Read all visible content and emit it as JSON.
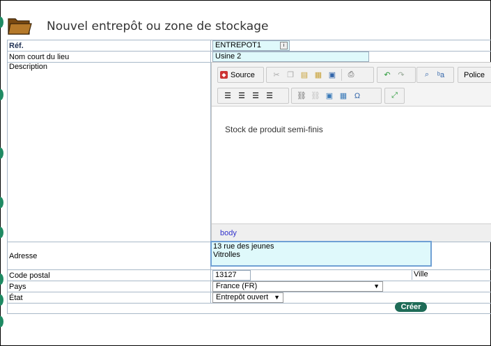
{
  "title": "Nouvel entrepôt ou zone de stockage",
  "fields": {
    "ref_label": "Réf.",
    "ref_value": "ENTREPOT1",
    "short_name_label": "Nom court du lieu",
    "short_name_value": "Usine 2",
    "description_label": "Description",
    "address_label": "Adresse",
    "address_value": "13 rue des jeunes\nVitrolles",
    "postal_label": "Code postal",
    "postal_value": "13127",
    "city_label": "Ville",
    "country_label": "Pays",
    "country_value": "France (FR)",
    "state_label": "État",
    "state_value": "Entrepôt ouvert"
  },
  "editor": {
    "source_label": "Source",
    "font_label": "Police",
    "content": "Stock de produit semi-finis",
    "path": "body",
    "toolbar1_icons": [
      "cut-icon",
      "copy-icon",
      "paste-icon",
      "paste-text-icon",
      "paste-word-icon",
      "print-icon",
      "undo-icon",
      "redo-icon",
      "find-icon",
      "replace-icon"
    ],
    "toolbar2_icons": [
      "align-left-icon",
      "align-center-icon",
      "align-right-icon",
      "align-justify-icon",
      "link-icon",
      "unlink-icon",
      "image-icon",
      "table-icon",
      "special-char-icon",
      "maximize-icon"
    ]
  },
  "submit_label": "Créer"
}
